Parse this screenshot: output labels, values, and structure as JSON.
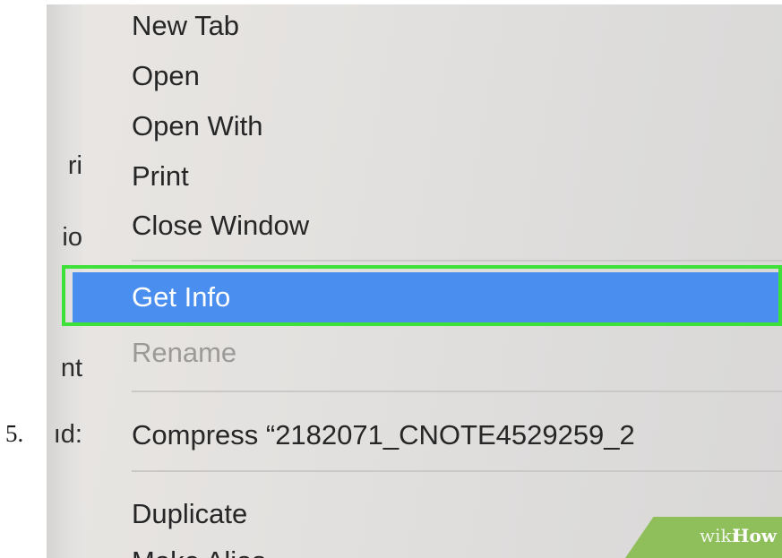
{
  "step_number": "5.",
  "sidebar_fragments": [
    "ri",
    "io",
    "nt",
    "ıd:"
  ],
  "menu": {
    "items": [
      {
        "label": "New Tab",
        "state": "normal"
      },
      {
        "label": "Open",
        "state": "normal"
      },
      {
        "label": "Open With",
        "state": "normal"
      },
      {
        "label": "Print",
        "state": "normal"
      },
      {
        "label": "Close Window",
        "state": "normal"
      },
      {
        "label": "Get Info",
        "state": "selected"
      },
      {
        "label": "Rename",
        "state": "disabled"
      },
      {
        "label": "Compress “2182071_CNOTE4529259_2",
        "state": "normal"
      },
      {
        "label": "Duplicate",
        "state": "normal"
      },
      {
        "label": "Make Alias",
        "state": "normal"
      }
    ]
  },
  "highlight_color": "#3ee03a",
  "selection_color": "#4a8ff0",
  "watermark": {
    "wiki": "wiki",
    "how": "How"
  }
}
